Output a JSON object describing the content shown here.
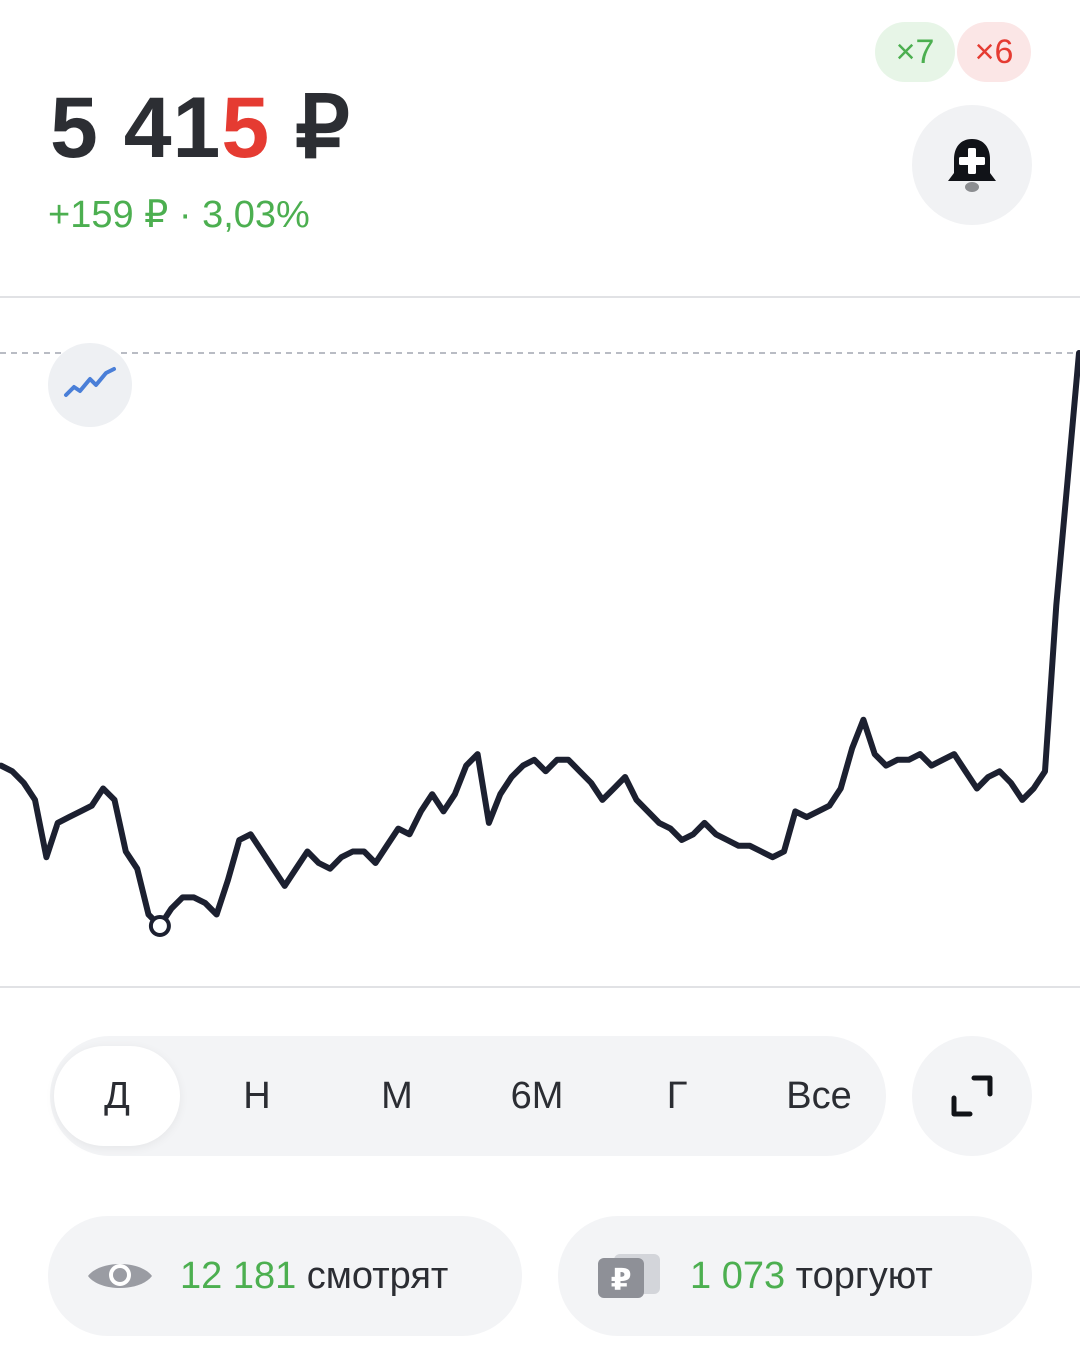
{
  "header": {
    "price_main": "5 41",
    "price_last_digit": "5",
    "currency": "₽",
    "change": "+159 ₽ · 3,03%",
    "badge_up": "×7",
    "badge_down": "×6"
  },
  "icons": {
    "alert": "bell-plus-icon",
    "chart_type": "line-chart-icon",
    "expand": "expand-icon",
    "watchers": "eye-icon",
    "traders": "ruble-wallet-icon"
  },
  "colors": {
    "up": "#4caf50",
    "down": "#e53b32",
    "line": "#1c2030",
    "chart_type_icon": "#4a7fd8"
  },
  "chart_data": {
    "type": "line",
    "title": "",
    "series": [
      {
        "values": [
          0.28,
          0.27,
          0.25,
          0.22,
          0.12,
          0.18,
          0.19,
          0.2,
          0.21,
          0.24,
          0.22,
          0.13,
          0.1,
          0.02,
          0.0,
          0.03,
          0.05,
          0.05,
          0.04,
          0.02,
          0.08,
          0.15,
          0.16,
          0.13,
          0.1,
          0.07,
          0.1,
          0.13,
          0.11,
          0.1,
          0.12,
          0.13,
          0.13,
          0.11,
          0.14,
          0.17,
          0.16,
          0.2,
          0.23,
          0.2,
          0.23,
          0.28,
          0.3,
          0.18,
          0.23,
          0.26,
          0.28,
          0.29,
          0.27,
          0.29,
          0.29,
          0.27,
          0.25,
          0.22,
          0.24,
          0.26,
          0.22,
          0.2,
          0.18,
          0.17,
          0.15,
          0.16,
          0.18,
          0.16,
          0.15,
          0.14,
          0.14,
          0.13,
          0.12,
          0.13,
          0.2,
          0.19,
          0.2,
          0.21,
          0.24,
          0.31,
          0.36,
          0.3,
          0.28,
          0.29,
          0.29,
          0.3,
          0.28,
          0.29,
          0.3,
          0.27,
          0.24,
          0.26,
          0.27,
          0.25,
          0.22,
          0.24,
          0.27,
          0.56,
          0.78,
          1.0
        ]
      }
    ],
    "grid": false,
    "reference_line": "dashed line at latest price",
    "marker": "open circle at period low"
  },
  "periods": [
    {
      "label": "Д",
      "active": true
    },
    {
      "label": "Н",
      "active": false
    },
    {
      "label": "М",
      "active": false
    },
    {
      "label": "6М",
      "active": false
    },
    {
      "label": "Г",
      "active": false
    },
    {
      "label": "Все",
      "active": false
    }
  ],
  "stats": {
    "watchers_count": "12 181",
    "watchers_label": " смотрят",
    "traders_count": "1 073",
    "traders_label": " торгуют"
  }
}
